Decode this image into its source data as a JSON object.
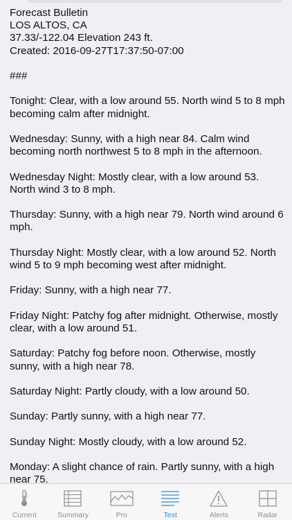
{
  "header": {
    "title": "Forecast Bulletin",
    "location": "LOS ALTOS, CA",
    "coordinates": "37.33/-122.04 Elevation 243 ft.",
    "created": "Created: 2016-09-27T17:37:50-07:00",
    "separator": "###"
  },
  "forecast": [
    "Tonight: Clear, with a low around 55. North wind 5 to 8 mph becoming calm  after midnight.",
    "Wednesday: Sunny, with a high near 84. Calm wind becoming north northwest 5 to 8 mph in the afternoon.",
    "Wednesday Night: Mostly clear, with a low around 53. North wind 3 to 8 mph.",
    "Thursday: Sunny, with a high near 79. North wind around 6 mph.",
    "Thursday Night: Mostly clear, with a low around 52. North wind 5 to 9 mph becoming west after midnight.",
    "Friday: Sunny, with a high near 77.",
    "Friday Night: Patchy fog after midnight.  Otherwise, mostly clear, with a low around 51.",
    "Saturday: Patchy fog before noon.  Otherwise, mostly sunny, with a high near 78.",
    "Saturday Night: Partly cloudy, with a low around 50.",
    "Sunday: Partly sunny, with a high near 77.",
    "Sunday Night: Mostly cloudy, with a low around 52.",
    "Monday: A slight chance of rain.  Partly sunny, with a high near 75."
  ],
  "tabs": [
    {
      "label": "Current",
      "icon": "thermometer-icon"
    },
    {
      "label": "Summary",
      "icon": "summary-list-icon"
    },
    {
      "label": "Pro",
      "icon": "pro-chart-icon"
    },
    {
      "label": "Text",
      "icon": "text-lines-icon"
    },
    {
      "label": "Alerts",
      "icon": "alert-triangle-icon"
    },
    {
      "label": "Radar",
      "icon": "radar-grid-icon"
    }
  ],
  "active_tab": "Text",
  "colors": {
    "background": "#efeff4",
    "tab_active": "#2f8bd6",
    "tab_inactive": "#8e8e93"
  }
}
